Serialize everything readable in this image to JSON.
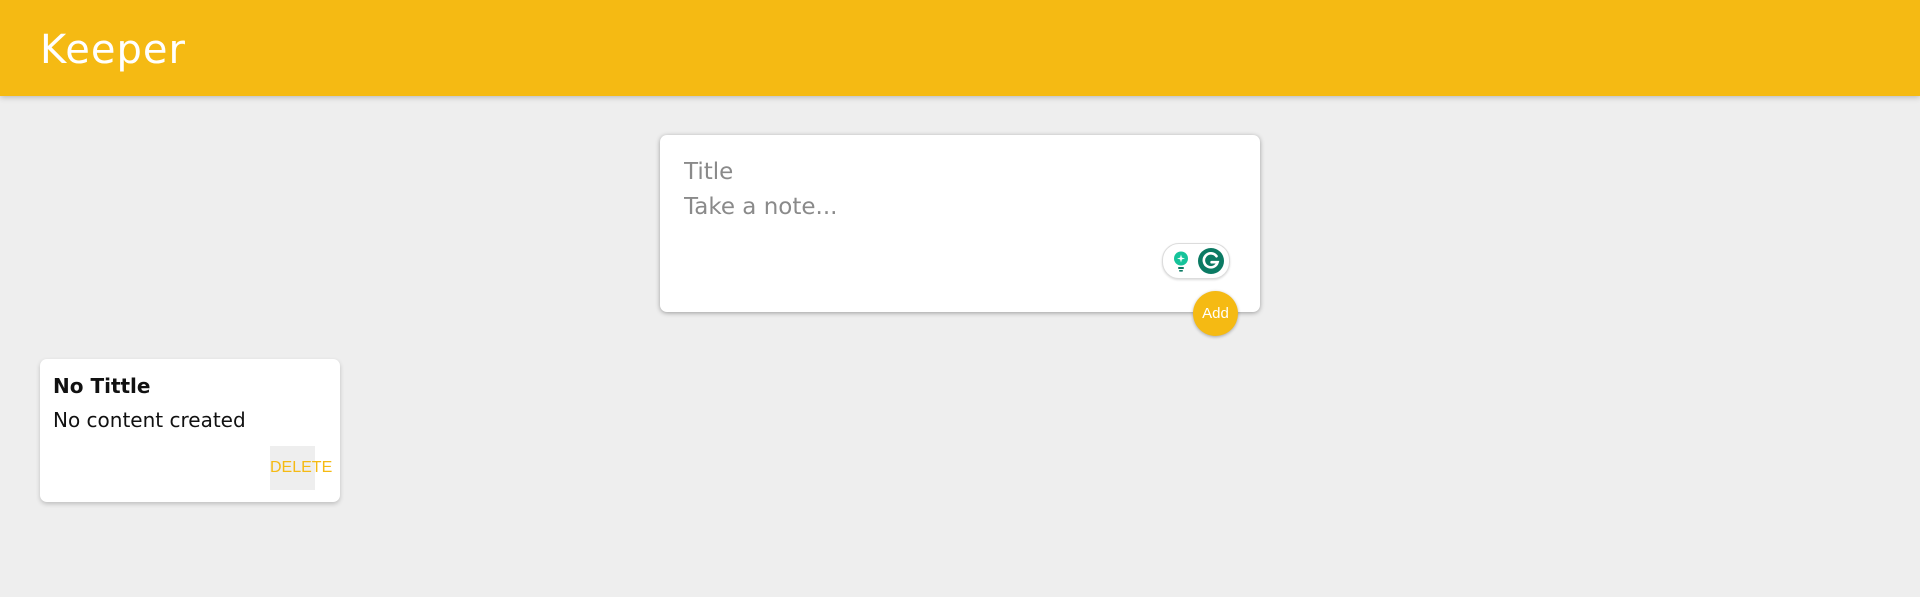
{
  "header": {
    "title": "Keeper"
  },
  "create_area": {
    "title_placeholder": "Title",
    "content_placeholder": "Take a note...",
    "add_label": "Add"
  },
  "notes": [
    {
      "title": "No Tittle",
      "content": "No content created",
      "delete_label": "DELETE"
    }
  ],
  "icons": {
    "grammarly_suggestion": "lightbulb-icon",
    "grammarly_logo": "grammarly-g-icon"
  },
  "colors": {
    "accent": "#f5ba13",
    "background": "#eeeeee",
    "card": "#ffffff",
    "grammarly_green": "#15c39a",
    "grammarly_dark": "#0b7a63"
  }
}
